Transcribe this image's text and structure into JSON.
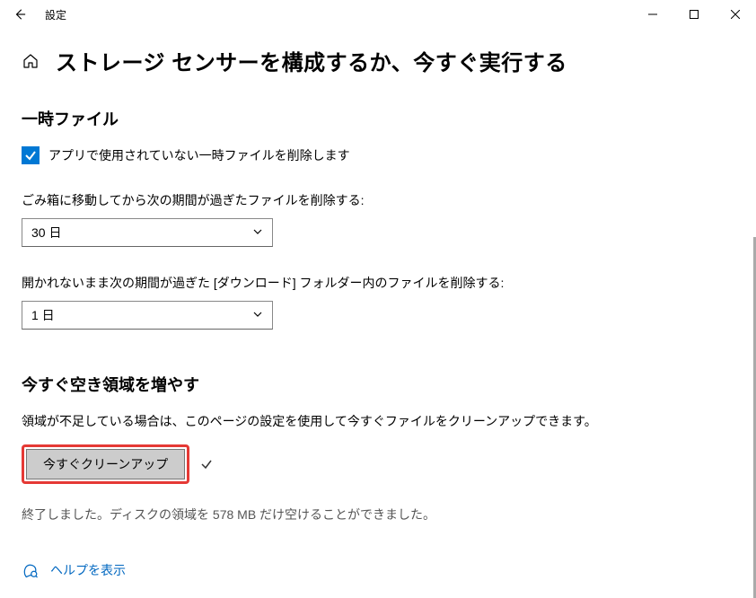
{
  "titlebar": {
    "app_title": "設定"
  },
  "page": {
    "title": "ストレージ センサーを構成するか、今すぐ実行する"
  },
  "temp_files": {
    "heading": "一時ファイル",
    "checkbox_label": "アプリで使用されていない一時ファイルを削除します",
    "recycle_label": "ごみ箱に移動してから次の期間が過ぎたファイルを削除する:",
    "recycle_value": "30 日",
    "downloads_label": "開かれないまま次の期間が過ぎた [ダウンロード] フォルダー内のファイルを削除する:",
    "downloads_value": "1 日"
  },
  "free_space": {
    "heading": "今すぐ空き領域を増やす",
    "description": "領域が不足している場合は、このページの設定を使用して今すぐファイルをクリーンアップできます。",
    "button_label": "今すぐクリーンアップ",
    "result_text": "終了しました。ディスクの領域を 578 MB だけ空けることができました。"
  },
  "help": {
    "link_text": "ヘルプを表示"
  }
}
